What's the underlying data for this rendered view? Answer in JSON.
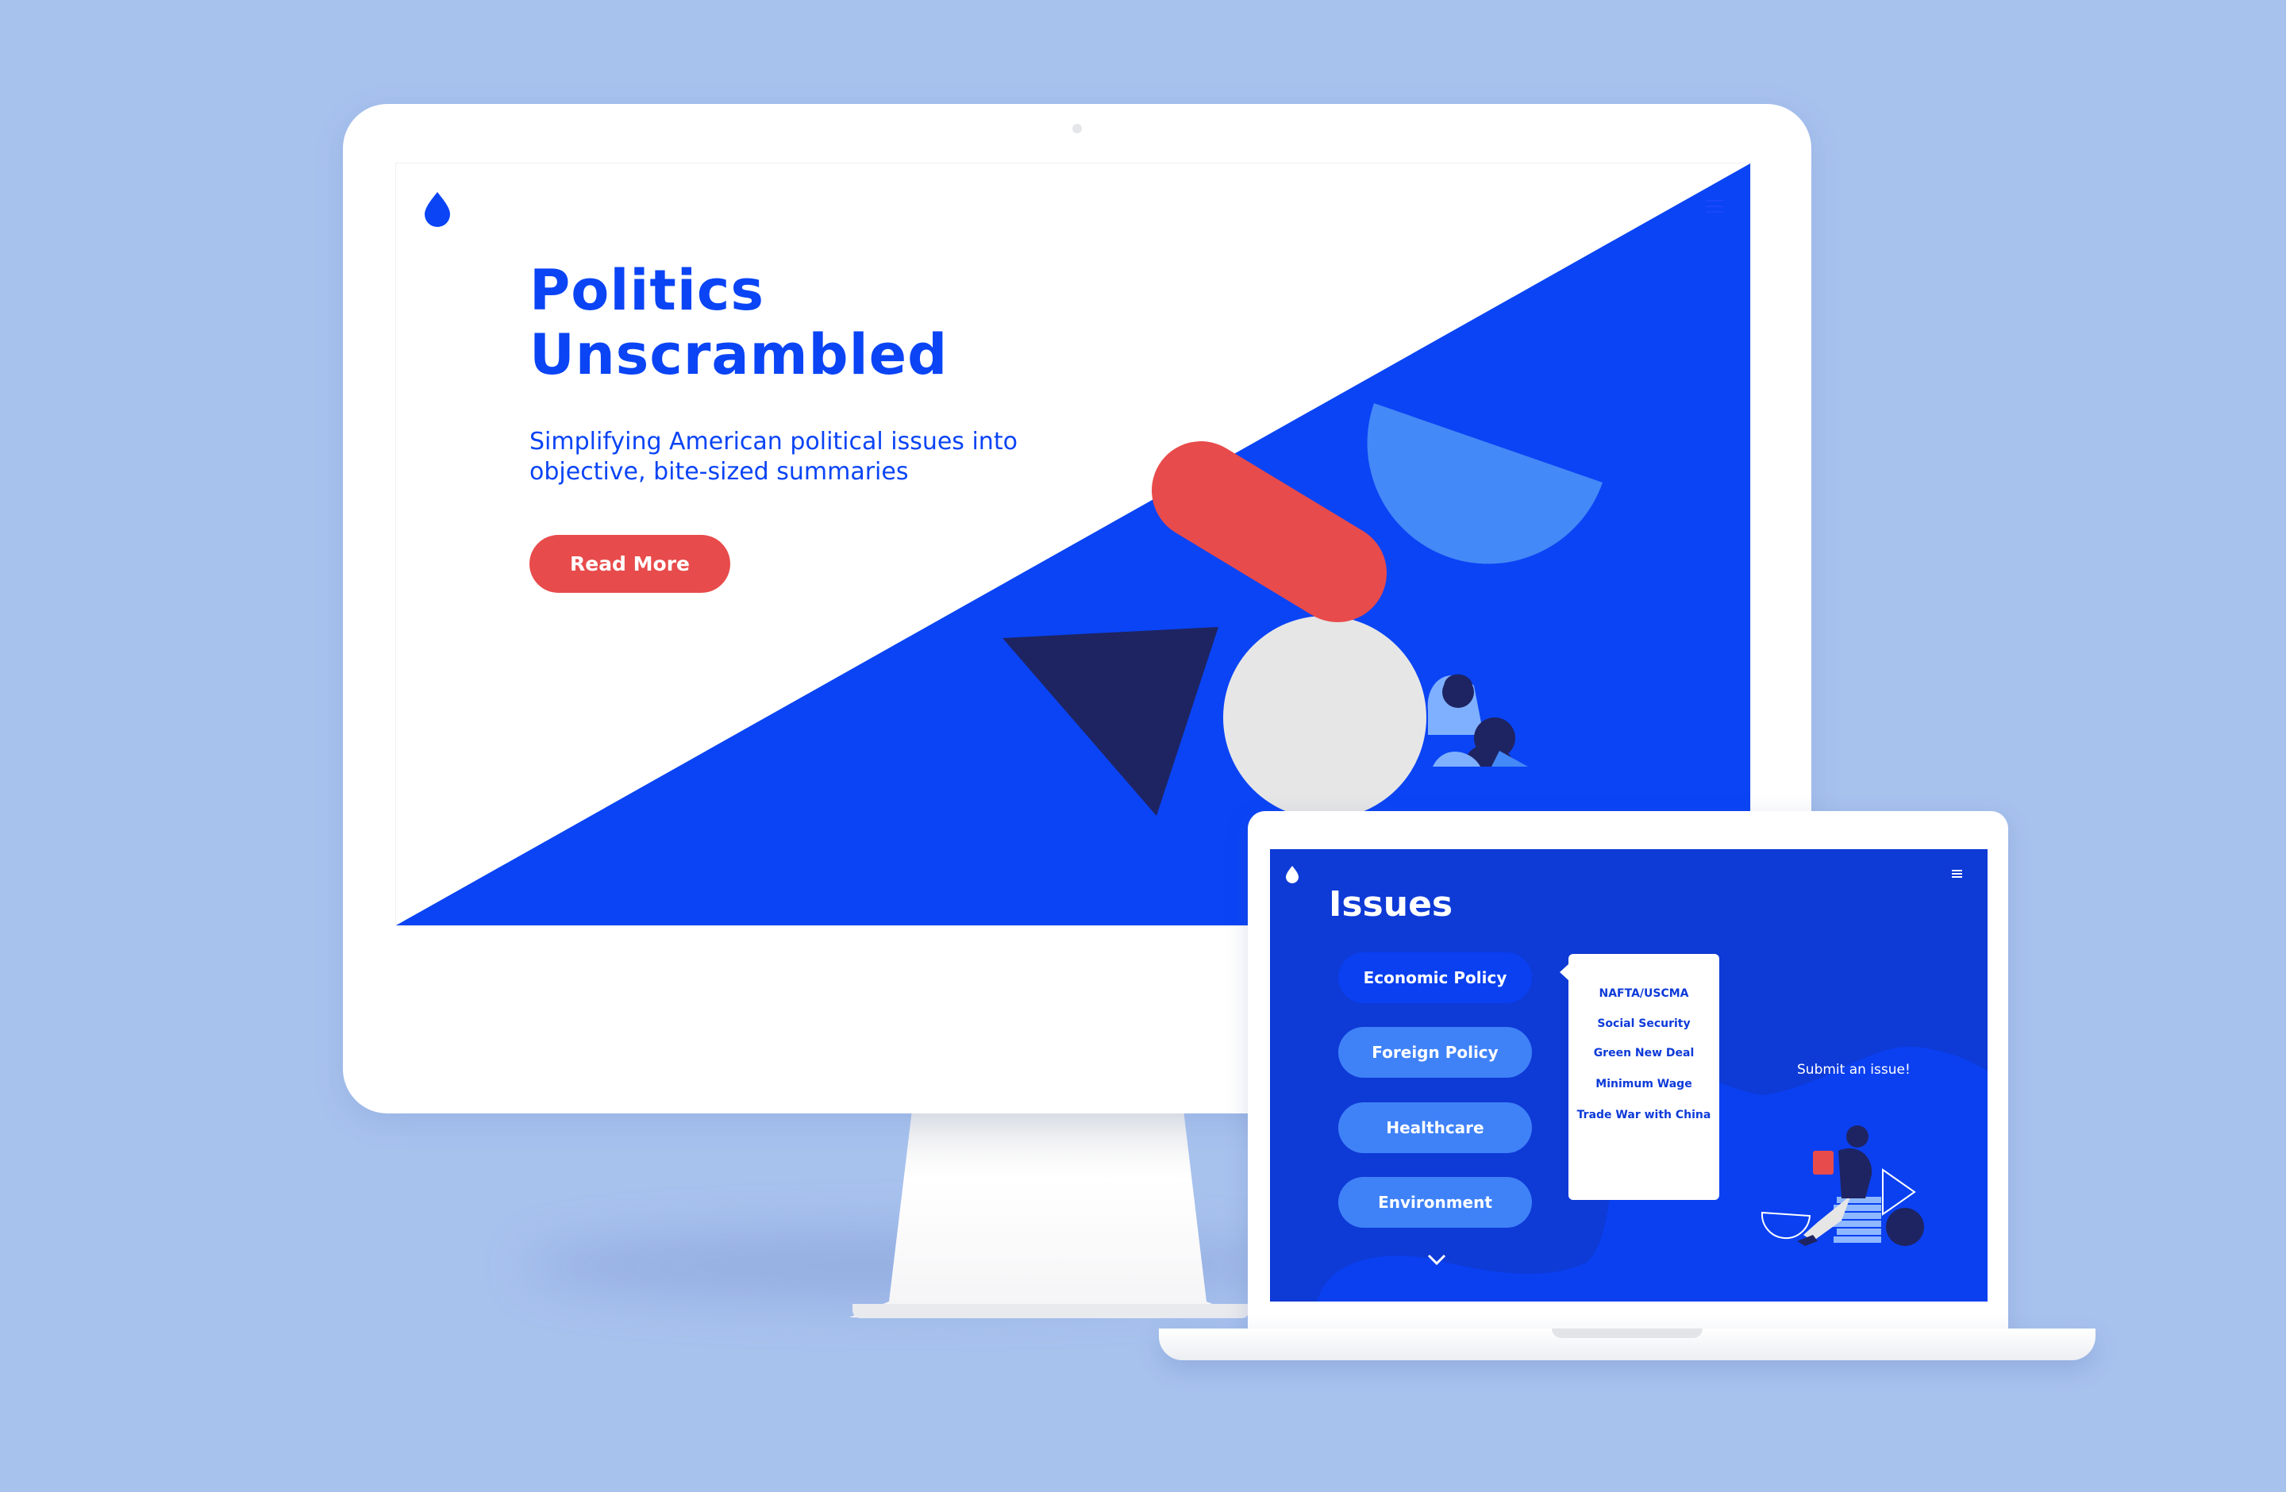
{
  "desktop": {
    "hero": {
      "title": "Politics\nUnscrambled",
      "subtitle": "Simplifying American political issues into objective, bite-sized summaries",
      "cta_label": "Read More"
    },
    "colors": {
      "brand_blue": "#0a44f5",
      "accent_red": "#e84b4b",
      "light_blue": "#4389f7",
      "navy": "#1e2462"
    }
  },
  "laptop": {
    "title": "Issues",
    "categories": [
      {
        "label": "Economic Policy",
        "active": true
      },
      {
        "label": "Foreign Policy",
        "active": false
      },
      {
        "label": "Healthcare",
        "active": false
      },
      {
        "label": "Environment",
        "active": false
      }
    ],
    "dropdown_items": [
      "NAFTA/USCMA",
      "Social Security",
      "Green New Deal",
      "Minimum Wage",
      "Trade War with China"
    ],
    "submit_label": "Submit an issue!"
  },
  "icons": {
    "logo": "drop-logo-icon",
    "menu": "hamburger-menu-icon",
    "more": "chevron-down-icon"
  }
}
